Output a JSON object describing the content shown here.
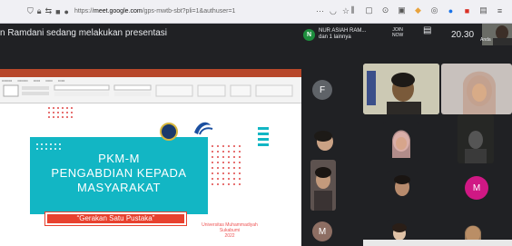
{
  "browser": {
    "url_prefix": "https://",
    "url_domain": "meet.google.com",
    "url_rest": "/gps-mwtb-sbt?pli=1&authuser=1"
  },
  "meet": {
    "presenting_text": "n Ramdani sedang melakukan presentasi",
    "chip_initial": "N",
    "chip_name": "NUR ASIAH RAM...",
    "chip_sub": "dan 1 lainnya",
    "ctrl_left": "JOIN\nNOW",
    "clock": "20.30",
    "self_label": "Anda"
  },
  "slide": {
    "title": "PKM-M\nPENGABDIAN KEPADA\nMASYARAKAT",
    "quote": "“Gerakan Satu Pustaka”",
    "university": "Universitas Muhammadiyah\nSukabumi\n2022"
  },
  "participants": [
    {
      "initial": "F",
      "color": "#5f6368"
    },
    {
      "initial": "M",
      "color": "#d01884"
    },
    {
      "initial": "M",
      "color": "#8d6e63"
    }
  ],
  "colors": {
    "accent": "#12b6c4",
    "slide_red": "#e8412e",
    "chip_green": "#1e8e3e",
    "meet_bg": "#202124"
  }
}
